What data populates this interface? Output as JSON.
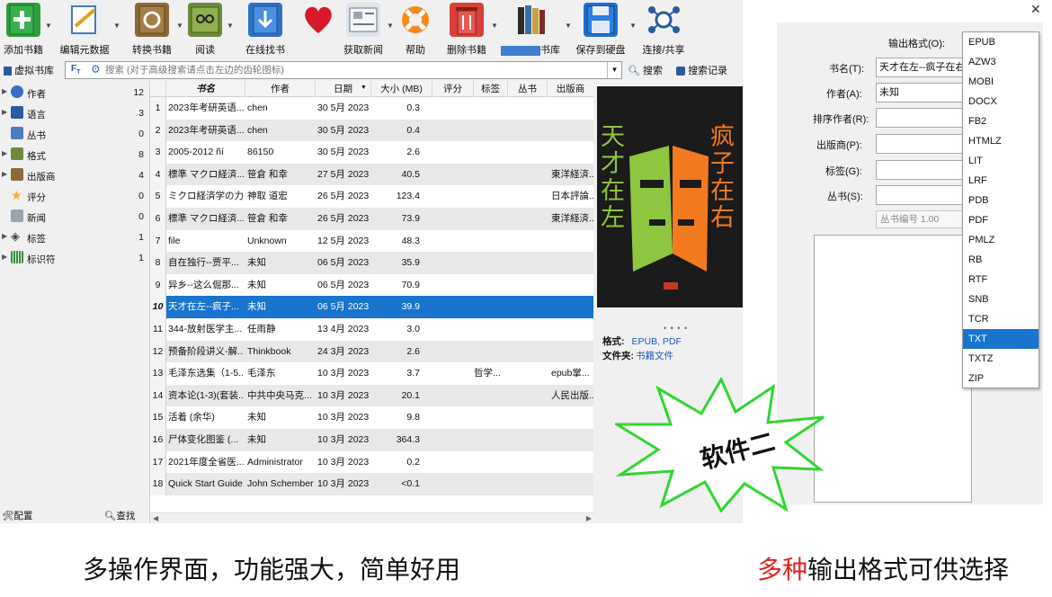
{
  "toolbar": {
    "add_books": "添加书籍",
    "edit_metadata": "编辑元数据",
    "convert_books": "转换书籍",
    "view": "阅读",
    "find_books": "在线找书",
    "fetch_news": "获取新闻",
    "help": "帮助",
    "remove_books": "删除书籍",
    "library": "书库",
    "save_to_disk": "保存到硬盘",
    "connect_share": "连接/共享"
  },
  "searchbar": {
    "virtual_library": "虚拟书库",
    "placeholder": "搜索 (对于高级搜索请点击左边的齿轮图标)",
    "search_button": "搜索",
    "saved_searches": "搜索记录"
  },
  "tag_browser": {
    "items": [
      {
        "label": "作者",
        "count": "12"
      },
      {
        "label": "语言",
        "count": "3"
      },
      {
        "label": "丛书",
        "count": "0"
      },
      {
        "label": "格式",
        "count": "8"
      },
      {
        "label": "出版商",
        "count": "4"
      },
      {
        "label": "评分",
        "count": "0"
      },
      {
        "label": "新闻",
        "count": "0"
      },
      {
        "label": "标签",
        "count": "1"
      },
      {
        "label": "标识符",
        "count": "1"
      }
    ],
    "configure": "配置",
    "find": "查找"
  },
  "book_list": {
    "columns": [
      "书名",
      "作者",
      "日期",
      "大小 (MB)",
      "评分",
      "标签",
      "丛书",
      "出版商"
    ],
    "rows": [
      {
        "n": "1",
        "title": "2023年考研英语...",
        "author": "chen",
        "date": "30 5月 2023",
        "size": "0.3",
        "tags": "",
        "publisher": ""
      },
      {
        "n": "2",
        "title": "2023年考研英语...",
        "author": "chen",
        "date": "30 5月 2023",
        "size": "0.4",
        "tags": "",
        "publisher": ""
      },
      {
        "n": "3",
        "title": "2005-2012 ñí",
        "author": "86150",
        "date": "30 5月 2023",
        "size": "2.6",
        "tags": "",
        "publisher": ""
      },
      {
        "n": "4",
        "title": "標準 マクロ経済...",
        "author": "笹倉 和幸",
        "date": "27 5月 2023",
        "size": "40.5",
        "tags": "",
        "publisher": "東洋経済..."
      },
      {
        "n": "5",
        "title": "ミクロ経済学の力",
        "author": "神取 道宏",
        "date": "26 5月 2023",
        "size": "123.4",
        "tags": "",
        "publisher": "日本評論..."
      },
      {
        "n": "6",
        "title": "標準 マクロ経済...",
        "author": "笹倉 和幸",
        "date": "26 5月 2023",
        "size": "73.9",
        "tags": "",
        "publisher": "東洋経済..."
      },
      {
        "n": "7",
        "title": "file",
        "author": "Unknown",
        "date": "12 5月 2023",
        "size": "48.3",
        "tags": "",
        "publisher": ""
      },
      {
        "n": "8",
        "title": "自在独行--贾平...",
        "author": "未知",
        "date": "06 5月 2023",
        "size": "35.9",
        "tags": "",
        "publisher": ""
      },
      {
        "n": "9",
        "title": "异乡--这么倔那...",
        "author": "未知",
        "date": "06 5月 2023",
        "size": "70.9",
        "tags": "",
        "publisher": ""
      },
      {
        "n": "10",
        "title": "天才在左--疯子...",
        "author": "未知",
        "date": "06 5月 2023",
        "size": "39.9",
        "tags": "",
        "publisher": ""
      },
      {
        "n": "11",
        "title": "344-放射医学主...",
        "author": "任雨静",
        "date": "13 4月 2023",
        "size": "3.0",
        "tags": "",
        "publisher": ""
      },
      {
        "n": "12",
        "title": "预备阶段讲义-解...",
        "author": "Thinkbook",
        "date": "24 3月 2023",
        "size": "2.6",
        "tags": "",
        "publisher": ""
      },
      {
        "n": "13",
        "title": "毛泽东选集（1-5...",
        "author": "毛泽东",
        "date": "10 3月 2023",
        "size": "3.7",
        "tags": "哲学...",
        "publisher": "epub掌..."
      },
      {
        "n": "14",
        "title": "资本论(1-3)(套装...",
        "author": "中共中央马克...",
        "date": "10 3月 2023",
        "size": "20.1",
        "tags": "",
        "publisher": "人民出版..."
      },
      {
        "n": "15",
        "title": "活着 (余华)",
        "author": "未知",
        "date": "10 3月 2023",
        "size": "9.8",
        "tags": "",
        "publisher": ""
      },
      {
        "n": "16",
        "title": "尸体变化图鉴 (...",
        "author": "未知",
        "date": "10 3月 2023",
        "size": "364.3",
        "tags": "",
        "publisher": ""
      },
      {
        "n": "17",
        "title": "2021年度全省医...",
        "author": "Administrator",
        "date": "10 3月 2023",
        "size": "0.2",
        "tags": "",
        "publisher": ""
      },
      {
        "n": "18",
        "title": "Quick Start Guide",
        "author": "John Schember",
        "date": "10 3月 2023",
        "size": "<0.1",
        "tags": "",
        "publisher": ""
      }
    ],
    "selected_index": 9
  },
  "details": {
    "cover_left_text": "天才在左",
    "cover_right_text": "疯子在右",
    "formats_label": "格式:",
    "formats_value": "EPUB, PDF",
    "folder_label": "文件夹:",
    "folder_value": "书籍文件"
  },
  "convert_dialog": {
    "close": "✕",
    "output_format_label": "输出格式(O):",
    "title_label": "书名(T):",
    "title_value": "天才在左--疯子在右",
    "author_label": "作者(A):",
    "author_value": "未知",
    "author_sort_label": "排序作者(R):",
    "publisher_label": "出版商(P):",
    "tags_label": "标签(G):",
    "series_label": "丛书(S):",
    "series_number": "丛书编号 1.00",
    "formats": [
      "EPUB",
      "AZW3",
      "MOBI",
      "DOCX",
      "FB2",
      "HTMLZ",
      "LIT",
      "LRF",
      "PDB",
      "PDF",
      "PMLZ",
      "RB",
      "RTF",
      "SNB",
      "TCR",
      "TXT",
      "TXTZ",
      "ZIP"
    ],
    "selected_format": "TXT"
  },
  "starburst_text": "软件二",
  "caption_left": "多操作界面，功能强大，简单好用",
  "caption_right_red": "多种",
  "caption_right_rest": "输出格式可供选择",
  "colors": {
    "selection": "#1874cd",
    "caption_accent": "#e02020",
    "starburst_stroke": "#33dd33"
  }
}
